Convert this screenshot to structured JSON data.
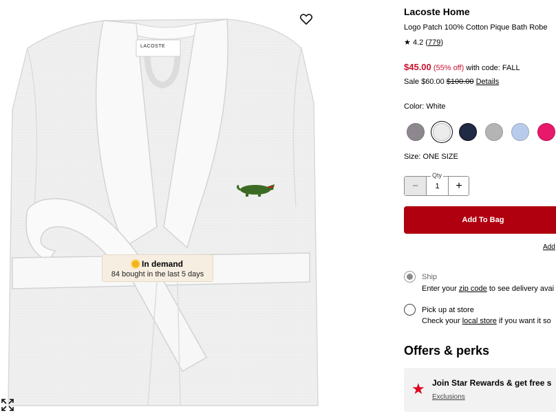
{
  "gallery": {
    "robe_logo_text": "LACOSTE",
    "badge": {
      "title": "In demand",
      "subtitle": "84 bought in the last 5 days"
    },
    "wishlist_icon": "heart-icon",
    "expand_icon": "expand-icon"
  },
  "product": {
    "brand": "Lacoste Home",
    "name": "Logo Patch 100% Cotton Pique Bath Robe",
    "rating": {
      "star": "★",
      "value": "4.2",
      "count": "779"
    },
    "price": {
      "sale_price": "$45.00",
      "percent_off": "(55% off)",
      "code_text": "with code: FALL"
    },
    "sale_line": {
      "sale_label": "Sale $60.00",
      "original": "$100.00",
      "details": "Details"
    },
    "color_label": "Color: White",
    "colors": [
      {
        "name": "Gray",
        "hex": "#8e8790"
      },
      {
        "name": "White",
        "hex": "#ececec"
      },
      {
        "name": "Navy",
        "hex": "#1f2a44"
      },
      {
        "name": "Heather",
        "hex": "#b4b4b4"
      },
      {
        "name": "Light Blue",
        "hex": "#b9cbec"
      },
      {
        "name": "Pink",
        "hex": "#e6196b"
      }
    ],
    "size_label": "Size: ONE SIZE",
    "quantity": {
      "label": "Qty",
      "value": "1",
      "minus": "−",
      "plus": "+"
    },
    "add_to_bag": "Add To Bag",
    "add_link": "Add"
  },
  "fulfillment": {
    "ship": {
      "title": "Ship",
      "desc_prefix": "Enter your ",
      "link": "zip code",
      "desc_suffix": " to see delivery avai"
    },
    "pickup": {
      "title": "Pick up at store",
      "desc_prefix": "Check your ",
      "link": "local store",
      "desc_suffix": " if you want it so"
    }
  },
  "offers": {
    "heading": "Offers & perks",
    "star_rewards": {
      "title": "Join Star Rewards & get free s",
      "link": "Exclusions"
    }
  },
  "colors": {
    "accent_red": "#c8102e",
    "button_red": "#b0000f"
  }
}
